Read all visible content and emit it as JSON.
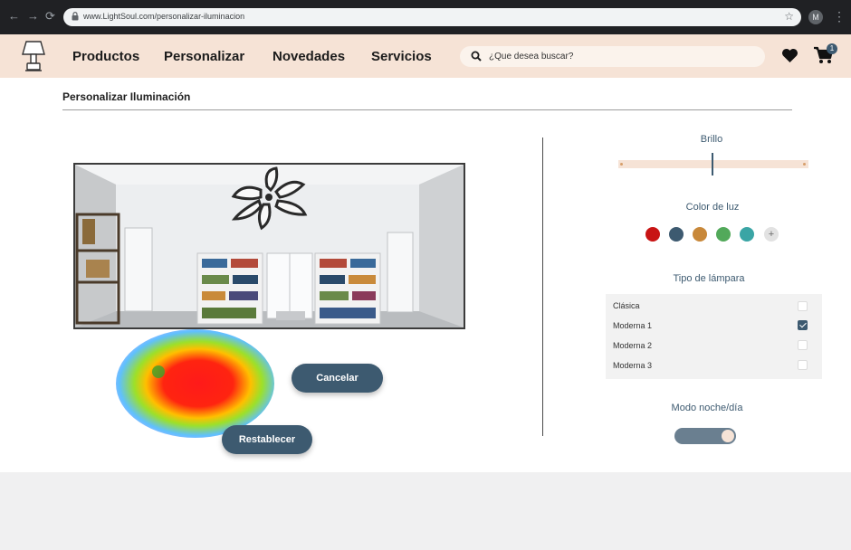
{
  "browser": {
    "url": "www.LightSoul.com/personalizar-iluminacion",
    "profile_initial": "M",
    "nav_back": "←",
    "nav_forward": "→",
    "nav_reload": "⟳",
    "bookmark_glyph": "☆",
    "menu_glyph": "⋮"
  },
  "header": {
    "menu": [
      "Productos",
      "Personalizar",
      "Novedades",
      "Servicios"
    ],
    "search_placeholder": "¿Que desea buscar?",
    "cart_count": "1"
  },
  "page": {
    "title": "Personalizar Iluminación",
    "buttons": {
      "cancel": "Cancelar",
      "reset": "Restablecer"
    }
  },
  "controls": {
    "brightness": {
      "label": "Brillo",
      "value_fraction": 0.5
    },
    "light_color": {
      "label": "Color de luz",
      "swatches": [
        "#c81414",
        "#3d5a70",
        "#c8883a",
        "#52a95a",
        "#3aa5a5"
      ],
      "add_glyph": "+"
    },
    "lamp_type": {
      "label": "Tipo de lámpara",
      "options": [
        {
          "label": "Clásica",
          "checked": false
        },
        {
          "label": "Moderna 1",
          "checked": true
        },
        {
          "label": "Moderna 2",
          "checked": false
        },
        {
          "label": "Moderna 3",
          "checked": false
        }
      ]
    },
    "night_mode": {
      "label": "Modo noche/día",
      "on": true
    }
  },
  "colors": {
    "header_bg": "#f6e3d6",
    "accent": "#3d5a70"
  }
}
